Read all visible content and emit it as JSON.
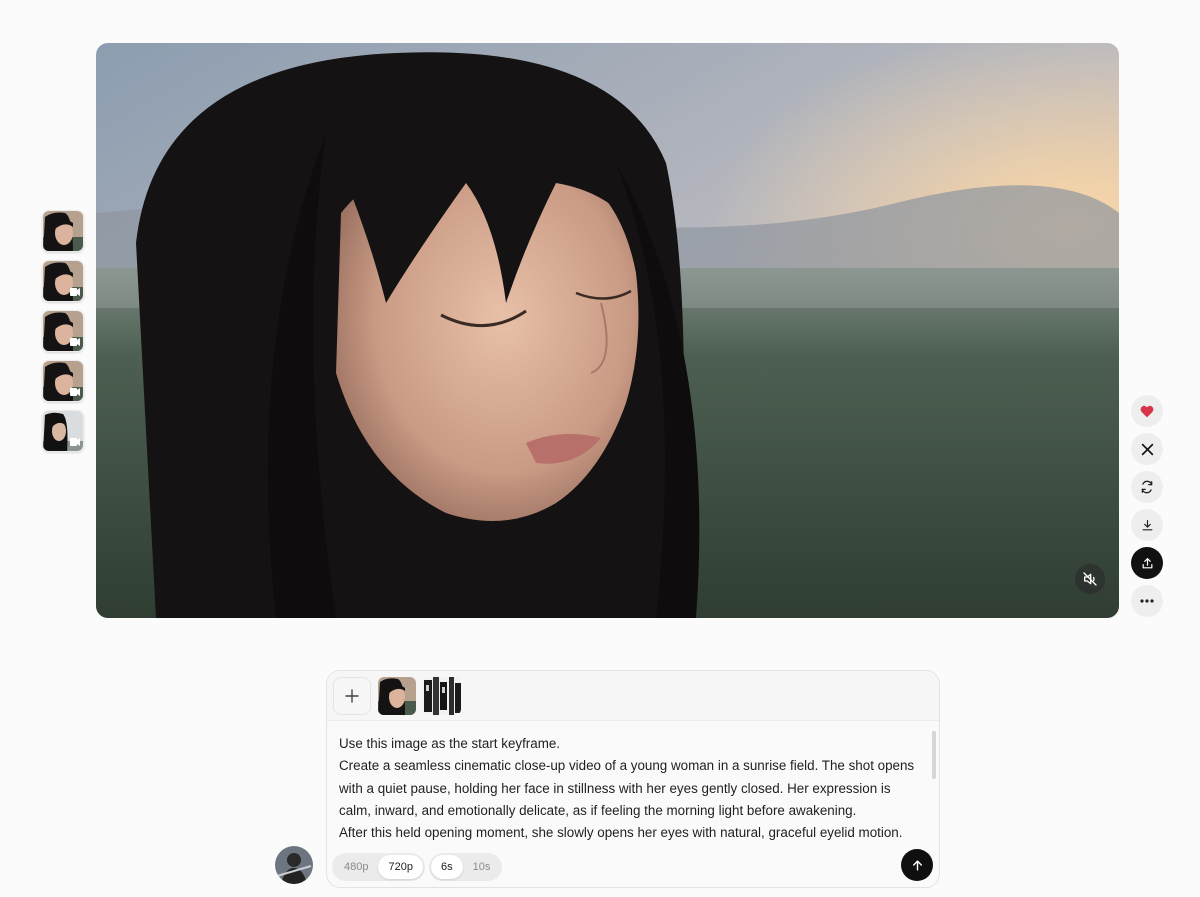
{
  "video": {
    "muted": true,
    "mute_icon": "speaker-muted-icon"
  },
  "thumbnails": [
    {
      "label": "generation-1",
      "has_video_icon": false
    },
    {
      "label": "generation-2",
      "has_video_icon": true
    },
    {
      "label": "generation-3",
      "has_video_icon": true
    },
    {
      "label": "generation-4",
      "has_video_icon": true
    },
    {
      "label": "generation-5",
      "has_video_icon": true
    }
  ],
  "actions": [
    "heart-icon",
    "x-logo-icon",
    "refresh-icon",
    "download-icon",
    "share-upload-icon",
    "more-icon"
  ],
  "composer": {
    "prompt_lines": [
      "Use this image as the start keyframe.",
      "Create a seamless cinematic close-up video of a young woman in a sunrise field. The shot opens",
      "with a quiet pause, holding her face in stillness with her eyes gently closed. Her expression is",
      "calm, inward, and emotionally delicate, as if feeling the morning light before awakening.",
      "After this held opening moment, she slowly opens her eyes with natural, graceful eyelid motion."
    ],
    "resolution_options": [
      "480p",
      "720p"
    ],
    "resolution_selected": "720p",
    "duration_options": [
      "6s",
      "10s"
    ],
    "duration_selected": "6s"
  },
  "colors": {
    "accent_heart": "#d8344a",
    "primary_dark": "#111111"
  }
}
